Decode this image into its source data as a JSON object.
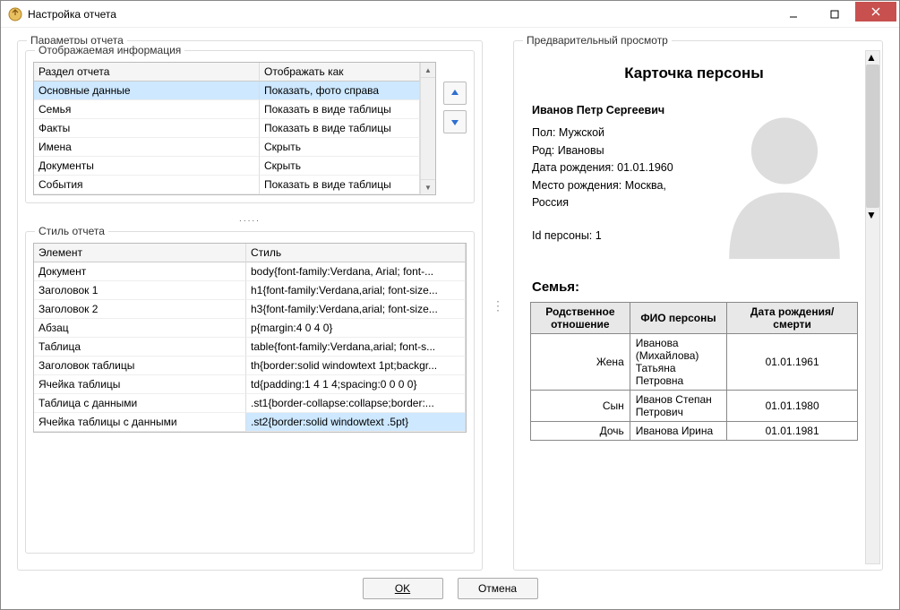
{
  "window": {
    "title": "Настройка отчета"
  },
  "left_group": {
    "label": "Параметры отчета"
  },
  "display_info": {
    "label": "Отображаемая информация",
    "headers": {
      "col1": "Раздел отчета",
      "col2": "Отображать как"
    },
    "rows": [
      {
        "section": "Основные данные",
        "mode": "Показать, фото справа",
        "selected": true
      },
      {
        "section": "Семья",
        "mode": "Показать в виде таблицы"
      },
      {
        "section": "Факты",
        "mode": "Показать в виде таблицы"
      },
      {
        "section": "Имена",
        "mode": "Скрыть"
      },
      {
        "section": "Документы",
        "mode": "Скрыть"
      },
      {
        "section": "События",
        "mode": "Показать в виде таблицы"
      }
    ]
  },
  "style": {
    "label": "Стиль отчета",
    "headers": {
      "col1": "Элемент",
      "col2": "Стиль"
    },
    "rows": [
      {
        "el": "Документ",
        "css": "body{font-family:Verdana, Arial; font-..."
      },
      {
        "el": "Заголовок 1",
        "css": "h1{font-family:Verdana,arial; font-size..."
      },
      {
        "el": "Заголовок 2",
        "css": "h3{font-family:Verdana,arial; font-size..."
      },
      {
        "el": "Абзац",
        "css": "p{margin:4 0 4 0}"
      },
      {
        "el": "Таблица",
        "css": "table{font-family:Verdana,arial; font-s..."
      },
      {
        "el": "Заголовок таблицы",
        "css": "th{border:solid windowtext 1pt;backgr..."
      },
      {
        "el": "Ячейка таблицы",
        "css": "td{padding:1 4 1 4;spacing:0 0 0 0}"
      },
      {
        "el": "Таблица с данными",
        "css": ".st1{border-collapse:collapse;border:..."
      },
      {
        "el": "Ячейка таблицы с данными",
        "css": ".st2{border:solid windowtext .5pt}",
        "selected": true
      }
    ]
  },
  "preview": {
    "label": "Предварительный просмотр",
    "title": "Карточка персоны",
    "person": {
      "name": "Иванов Петр Сергеевич",
      "sex_label": "Пол:",
      "sex": "Мужской",
      "clan_label": "Род:",
      "clan": "Ивановы",
      "birth_label": "Дата рождения:",
      "birth": "01.01.1960",
      "place_label": "Место рождения:",
      "place": "Москва, Россия",
      "id_label": "Id персоны:",
      "id": "1"
    },
    "family": {
      "heading": "Семья:",
      "headers": {
        "rel": "Родственное отношение",
        "name": "ФИО персоны",
        "date": "Дата рождения/смерти"
      },
      "rows": [
        {
          "rel": "Жена",
          "name": "Иванова (Михайлова) Татьяна Петровна",
          "date": "01.01.1961"
        },
        {
          "rel": "Сын",
          "name": "Иванов Степан Петрович",
          "date": "01.01.1980"
        },
        {
          "rel": "Дочь",
          "name": "Иванова Ирина",
          "date": "01.01.1981"
        }
      ]
    }
  },
  "footer": {
    "ok": "OK",
    "cancel": "Отмена"
  },
  "dots": "....."
}
